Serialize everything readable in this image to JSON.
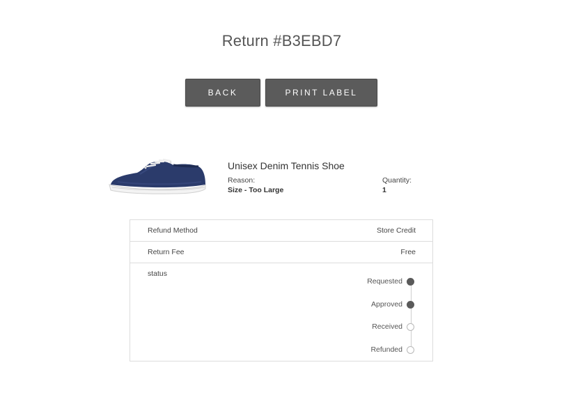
{
  "header": {
    "title": "Return #B3EBD7"
  },
  "actions": {
    "back_label": "BACK",
    "print_label": "PRINT LABEL"
  },
  "product": {
    "name": "Unisex Denim Tennis Shoe",
    "reason_label": "Reason:",
    "reason_value": "Size - Too Large",
    "quantity_label": "Quantity:",
    "quantity_value": "1",
    "image_icon": "denim-sneaker-image",
    "shoe_color": "#2b3b6b"
  },
  "details": {
    "refund_method_label": "Refund Method",
    "refund_method_value": "Store Credit",
    "return_fee_label": "Return Fee",
    "return_fee_value": "Free",
    "status_label": "status"
  },
  "status_steps": [
    {
      "label": "Requested",
      "done": true
    },
    {
      "label": "Approved",
      "done": true
    },
    {
      "label": "Received",
      "done": false
    },
    {
      "label": "Refunded",
      "done": false
    }
  ],
  "colors": {
    "button_bg": "#5b5b5b",
    "dot_filled": "#5a5a5a",
    "border": "#dcdcdc"
  }
}
